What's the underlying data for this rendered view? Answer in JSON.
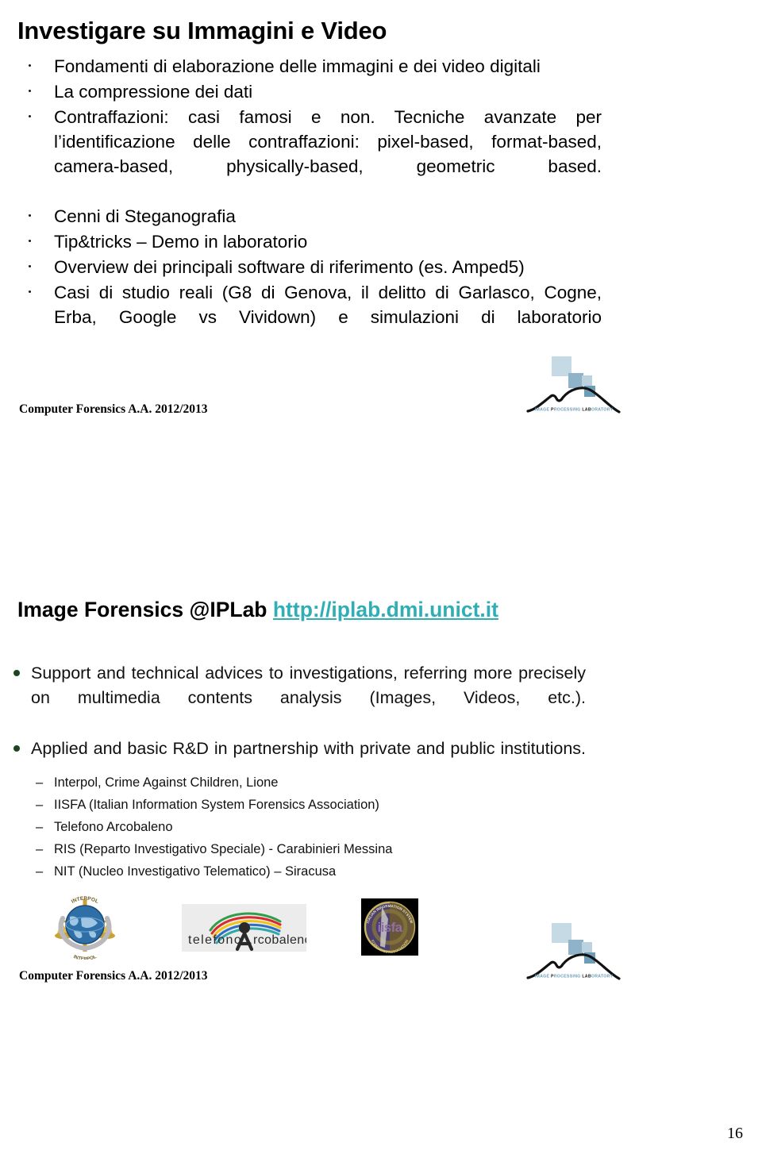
{
  "document": {
    "page_number": "16"
  },
  "slide_one": {
    "title": "Investigare su Immagini e Video",
    "bullets": [
      "Fondamenti di elaborazione delle immagini e dei video digitali",
      "La compressione dei dati",
      "Contraffazioni: casi famosi e non. Tecniche avanzate per l’identificazione delle contraffazioni: pixel-based, format-based, camera-based, physically-based, geometric based.",
      "Cenni di Steganografia",
      "Tip&tricks – Demo in laboratorio",
      "Overview dei principali software di riferimento (es. Amped5)",
      "Casi di studio reali (G8 di Genova, il delitto di Garlasco, Cogne, Erba, Google vs Vividown) e simulazioni di laboratorio"
    ],
    "footer": "Computer Forensics A.A. 2012/2013",
    "logo_label": "iplab-mountain-logo",
    "logo_text": "IMAGE PROCESSING LABORATORY"
  },
  "slide_two": {
    "title_prefix": "Image Forensics @IPLab ",
    "title_link": "http://iplab.dmi.unict.it",
    "bullets": [
      "Support and technical advices to investigations, referring more precisely on multimedia contents analysis (Images, Videos, etc.).",
      "Applied and basic R&D in partnership with private and public institutions."
    ],
    "sub_bullets": [
      "Interpol, Crime Against Children, Lione",
      "IISFA (Italian Information System Forensics Association)",
      "Telefono Arcobaleno",
      "RIS (Reparto Investigativo Speciale) - Carabinieri Messina",
      "NIT (Nucleo Investigativo Telematico) – Siracusa"
    ],
    "dash_marker": "–",
    "partner_logos": [
      {
        "name": "interpol-logo",
        "caption": "INTERPOL"
      },
      {
        "name": "telefono-arcobaleno-logo",
        "caption": "telefono Arcobaleno"
      },
      {
        "name": "iisfa-logo",
        "caption": "iisfa"
      }
    ],
    "footer": "Computer Forensics A.A. 2012/2013",
    "logo_label": "iplab-mountain-logo",
    "logo_text": "IMAGE PROCESSING LABORATORY"
  },
  "colors": {
    "link_teal": "#2FAFB5",
    "bullet_green": "#1D4520",
    "logo_blue_light": "#C3D7E4",
    "logo_blue_mid": "#8FB4C9",
    "logo_blue_dark": "#6C9CB6",
    "text_black": "#000000"
  }
}
